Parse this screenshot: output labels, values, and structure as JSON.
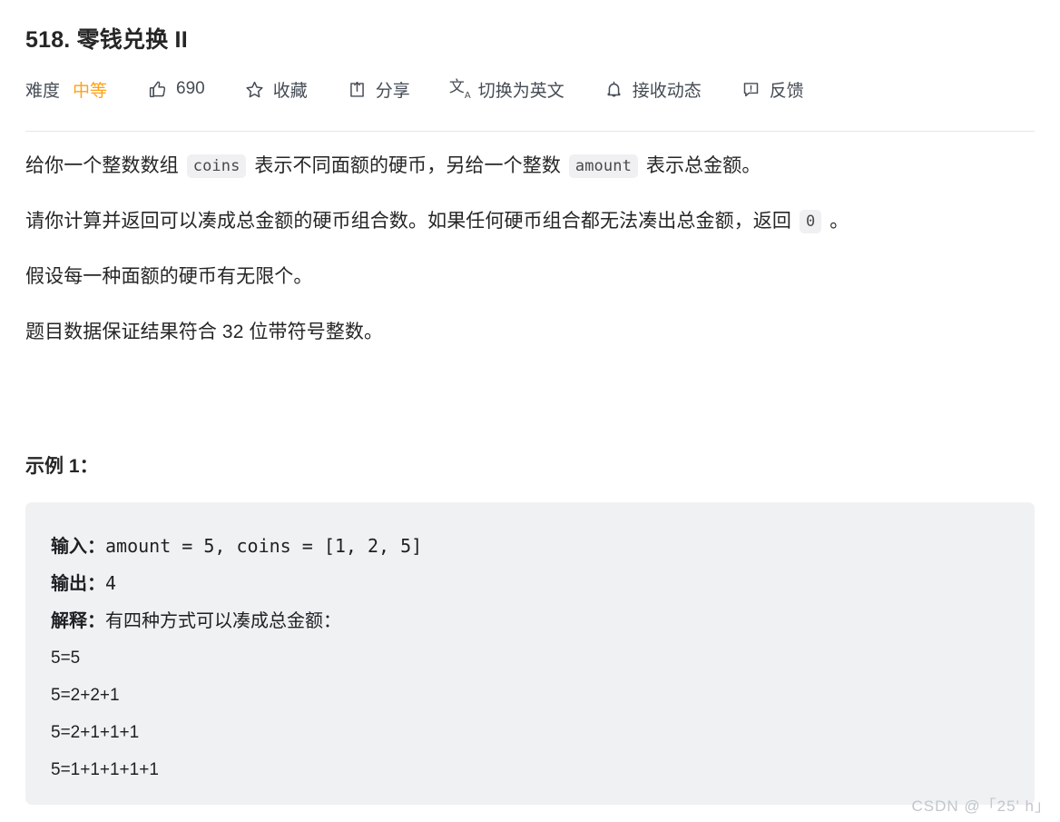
{
  "problem": {
    "title": "518. 零钱兑换 II"
  },
  "toolbar": {
    "difficulty_label": "难度",
    "difficulty_value": "中等",
    "difficulty_color": "#ffa116",
    "likes_count": "690",
    "likes_icon": "thumbs-up-icon",
    "favorite_label": "收藏",
    "favorite_icon": "star-icon",
    "share_label": "分享",
    "share_icon": "share-icon",
    "translate_label": "切换为英文",
    "translate_icon": "translate-icon",
    "subscribe_label": "接收动态",
    "subscribe_icon": "bell-icon",
    "feedback_label": "反馈",
    "feedback_icon": "feedback-icon"
  },
  "description": {
    "p1": {
      "seg1": "给你一个整数数组 ",
      "code1": "coins",
      "seg2": " 表示不同面额的硬币，另给一个整数 ",
      "code2": "amount",
      "seg3": " 表示总金额。"
    },
    "p2": {
      "seg1": "请你计算并返回可以凑成总金额的硬币组合数。如果任何硬币组合都无法凑出总金额，返回 ",
      "code1": "0",
      "seg2": " 。"
    },
    "p3": "假设每一种面额的硬币有无限个。",
    "p4": "题目数据保证结果符合 32 位带符号整数。"
  },
  "example": {
    "heading": "示例 1：",
    "lines": [
      {
        "label": "输入：",
        "text": "amount = 5, coins = [1, 2, 5]",
        "style": "mono"
      },
      {
        "label": "输出：",
        "text": "4",
        "style": "mono"
      },
      {
        "label": "解释：",
        "text": "有四种方式可以凑成总金额：",
        "style": "serif"
      },
      {
        "label": "",
        "text": "5=5",
        "style": "sans"
      },
      {
        "label": "",
        "text": "5=2+2+1",
        "style": "sans"
      },
      {
        "label": "",
        "text": "5=2+1+1+1",
        "style": "sans"
      },
      {
        "label": "",
        "text": "5=1+1+1+1+1",
        "style": "sans"
      }
    ]
  },
  "watermark": {
    "text": "CSDN @「25' h」"
  }
}
